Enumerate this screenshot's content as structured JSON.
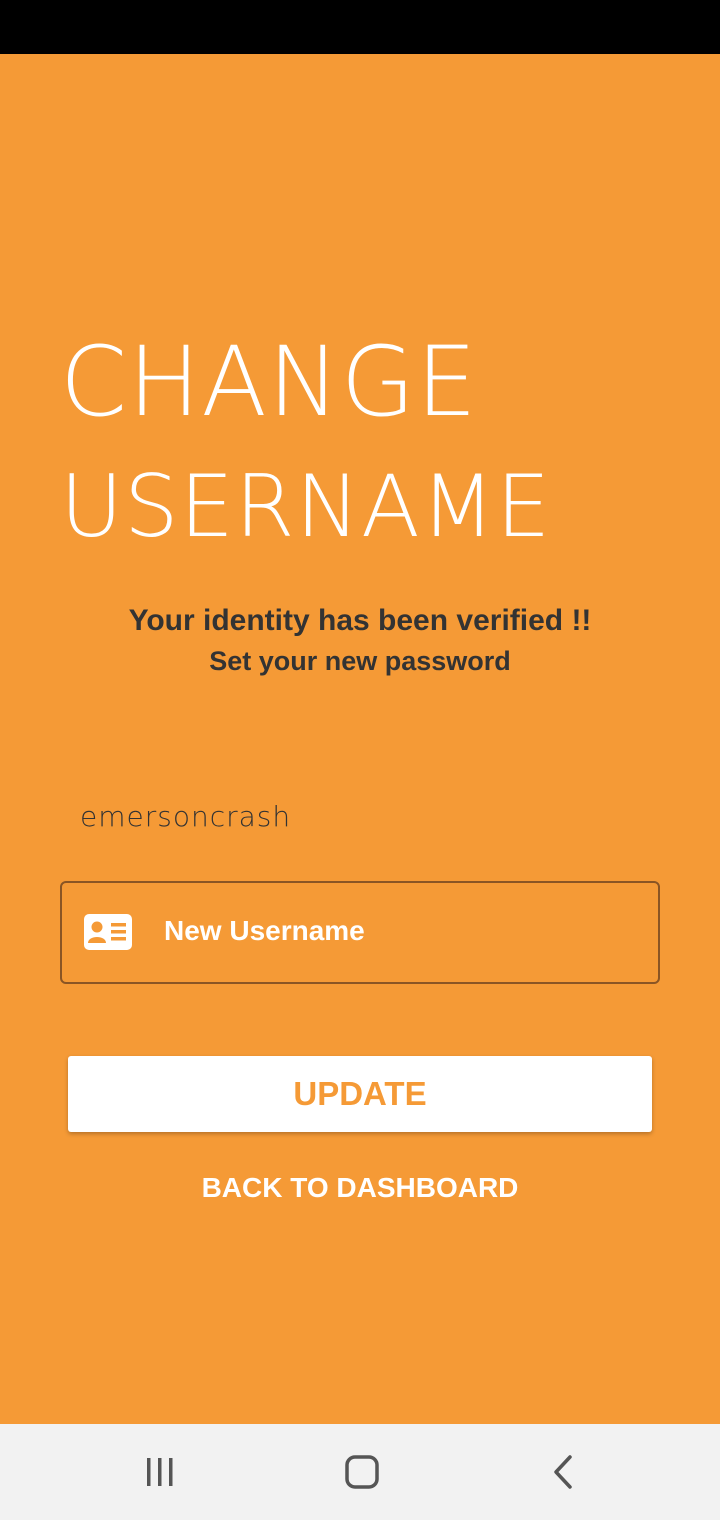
{
  "title": {
    "line1": "CHANGE",
    "line2": "USERNAME"
  },
  "subtitle": {
    "line1": "Your identity has been verified !!",
    "line2": "Set your new password"
  },
  "current_username": "emersoncrash",
  "new_username_input": {
    "placeholder": "New Username",
    "value": "",
    "icon": "id-card-icon"
  },
  "update_button_label": "UPDATE",
  "back_link_label": "BACK TO DASHBOARD",
  "colors": {
    "background": "#f59a36",
    "text_dark": "#333333",
    "white": "#ffffff",
    "input_border": "#8a5524",
    "nav_bar": "#f2f2f2",
    "nav_icon": "#555555"
  },
  "nav": {
    "recents_icon": "recents-icon",
    "home_icon": "home-icon",
    "back_icon": "back-arrow-icon"
  }
}
